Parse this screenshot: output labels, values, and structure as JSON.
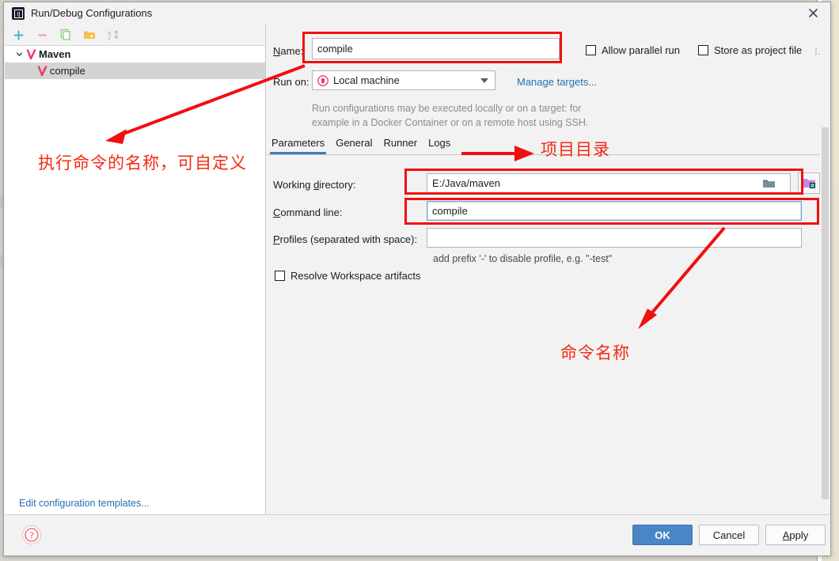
{
  "window": {
    "title": "Run/Debug Configurations",
    "app_icon": "intellij-idea-icon",
    "close_icon": "close-icon"
  },
  "left_panel": {
    "toolbar": [
      {
        "name": "add-configuration-button",
        "icon": "plus-icon",
        "glyph": "+",
        "color": "#56b6c2"
      },
      {
        "name": "remove-configuration-button",
        "icon": "minus-icon",
        "glyph": "−",
        "color": "#f0a0a0"
      },
      {
        "name": "copy-configuration-button",
        "icon": "copy-icon",
        "glyph": "❐",
        "color": "#8cc97f"
      },
      {
        "name": "save-configuration-button",
        "icon": "folder-add-icon",
        "glyph": "▮",
        "color": "#f2c14e"
      },
      {
        "name": "sort-configurations-button",
        "icon": "sort-alphabetically-icon",
        "glyph": "A̲Z",
        "color": "#b8b8b8"
      }
    ],
    "tree": [
      {
        "label": "Maven",
        "level": 0,
        "bold": true,
        "selected": false,
        "expanded": true,
        "icon": "maven-icon"
      },
      {
        "label": "compile",
        "level": 1,
        "bold": false,
        "selected": true,
        "expanded": false,
        "icon": "maven-icon"
      }
    ],
    "edit_templates_link": "Edit configuration templates..."
  },
  "main": {
    "name_label": "Name:",
    "name_label_mnemonic": "N",
    "name_value": "compile",
    "allow_parallel_run": {
      "label": "Allow parallel run",
      "checked": false
    },
    "store_as_project_file": {
      "label": "Store as project file",
      "checked": false,
      "more_icon": "more-options-icon"
    },
    "run_on_label": "Run on:",
    "run_on_value": "Local machine",
    "run_on_icon": "local-machine-icon",
    "manage_targets_link": "Manage targets...",
    "description_line1": "Run configurations may be executed locally or on a target: for",
    "description_line2": "example in a Docker Container or on a remote host using SSH.",
    "tabs": [
      {
        "label": "Parameters",
        "active": true
      },
      {
        "label": "General",
        "active": false
      },
      {
        "label": "Runner",
        "active": false
      },
      {
        "label": "Logs",
        "active": false
      }
    ],
    "working_directory": {
      "label": "Working directory:",
      "value": "E:/Java/maven",
      "browse_icon": "folder-icon",
      "module_icon": "module-folder-icon"
    },
    "command_line": {
      "label": "Command line:",
      "value": "compile",
      "focused": true
    },
    "profiles": {
      "label": "Profiles (separated with space):",
      "value": "",
      "hint": "add prefix '-' to disable profile, e.g. \"-test\""
    },
    "resolve_workspace_artifacts": {
      "label": "Resolve Workspace artifacts",
      "checked": false
    }
  },
  "footer": {
    "help_icon": "help-icon",
    "ok_label": "OK",
    "cancel_label": "Cancel",
    "apply_label": "Apply"
  },
  "annotations": {
    "accent_color": "#f42a12",
    "note_name": "执行命令的名称，可自定义",
    "note_project_dir": "项目目录",
    "note_command_name": "命令名称"
  }
}
